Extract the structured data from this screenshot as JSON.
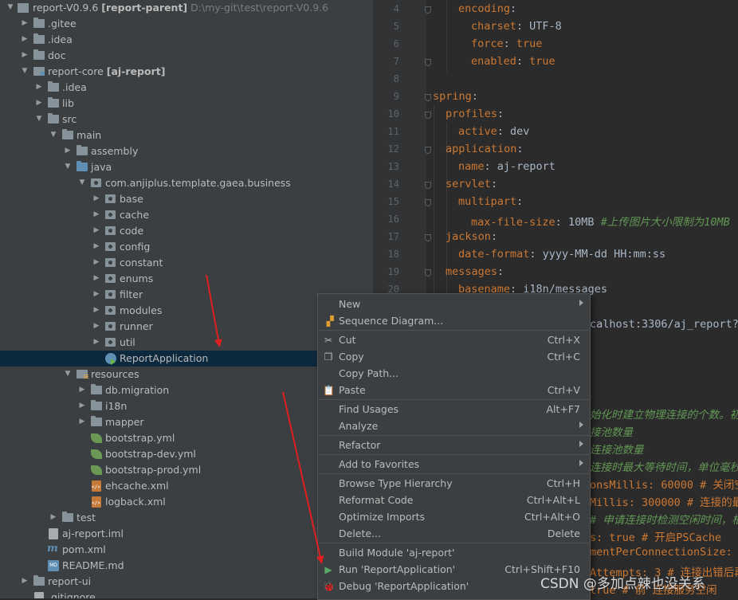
{
  "project": {
    "root_name": "report-V0.9.6",
    "root_module": "[report-parent]",
    "root_path": "D:\\my-git\\test\\report-V0.9.6",
    "items": [
      {
        "label": ".gitee"
      },
      {
        "label": ".idea"
      },
      {
        "label": "doc"
      },
      {
        "label": "report-core",
        "module": "[aj-report]"
      },
      {
        "label": ".idea"
      },
      {
        "label": "lib"
      },
      {
        "label": "src"
      },
      {
        "label": "main"
      },
      {
        "label": "assembly"
      },
      {
        "label": "java"
      },
      {
        "label": "com.anjiplus.template.gaea.business"
      },
      {
        "label": "base"
      },
      {
        "label": "cache"
      },
      {
        "label": "code"
      },
      {
        "label": "config"
      },
      {
        "label": "constant"
      },
      {
        "label": "enums"
      },
      {
        "label": "filter"
      },
      {
        "label": "modules"
      },
      {
        "label": "runner"
      },
      {
        "label": "util"
      },
      {
        "label": "ReportApplication"
      },
      {
        "label": "resources"
      },
      {
        "label": "db.migration"
      },
      {
        "label": "i18n"
      },
      {
        "label": "mapper"
      },
      {
        "label": "bootstrap.yml"
      },
      {
        "label": "bootstrap-dev.yml"
      },
      {
        "label": "bootstrap-prod.yml"
      },
      {
        "label": "ehcache.xml"
      },
      {
        "label": "logback.xml"
      },
      {
        "label": "test"
      },
      {
        "label": "aj-report.iml"
      },
      {
        "label": "pom.xml"
      },
      {
        "label": "README.md"
      },
      {
        "label": "report-ui"
      },
      {
        "label": ".gitignore"
      }
    ]
  },
  "editor": {
    "line_numbers": [
      "4",
      "5",
      "6",
      "7",
      "8",
      "9",
      "10",
      "11",
      "12",
      "13",
      "14",
      "15",
      "16",
      "17",
      "18",
      "19",
      "20"
    ],
    "lines": [
      {
        "key": "encoding",
        "sep": ":",
        "val": "",
        "comment": ""
      },
      {
        "key": "charset",
        "sep": ": ",
        "val": "UTF-8",
        "comment": ""
      },
      {
        "key": "force",
        "sep": ": ",
        "val": "true",
        "comment": ""
      },
      {
        "key": "enabled",
        "sep": ": ",
        "val": "true",
        "comment": ""
      },
      {
        "key": "",
        "sep": "",
        "val": "",
        "comment": ""
      },
      {
        "key": "spring",
        "sep": ":",
        "val": "",
        "comment": ""
      },
      {
        "key": "profiles",
        "sep": ":",
        "val": "",
        "comment": ""
      },
      {
        "key": "active",
        "sep": ": ",
        "val": "dev",
        "comment": ""
      },
      {
        "key": "application",
        "sep": ":",
        "val": "",
        "comment": ""
      },
      {
        "key": "name",
        "sep": ": ",
        "val": "aj-report",
        "comment": ""
      },
      {
        "key": "servlet",
        "sep": ":",
        "val": "",
        "comment": ""
      },
      {
        "key": "multipart",
        "sep": ":",
        "val": "",
        "comment": ""
      },
      {
        "key": "max-file-size",
        "sep": ": ",
        "val": "10MB ",
        "comment": "#上传图片大小限制为10MB"
      },
      {
        "key": "jackson",
        "sep": ":",
        "val": "",
        "comment": ""
      },
      {
        "key": "date-format",
        "sep": ": ",
        "val": "yyyy-MM-dd HH:mm:ss",
        "comment": ""
      },
      {
        "key": "messages",
        "sep": ":",
        "val": "",
        "comment": ""
      },
      {
        "key": "basename",
        "sep": ": ",
        "val": "i18n/messages",
        "comment": ""
      }
    ],
    "peek": [
      {
        "text": "calhost:3306/aj_report?c",
        "kind": "val"
      },
      {
        "text": "始化时建立物理连接的个数。初",
        "kind": "comment"
      },
      {
        "text": "接池数量",
        "kind": "comment"
      },
      {
        "text": "连接池数量",
        "kind": "comment"
      },
      {
        "text": "连接时最大等待时间，单位毫秒。",
        "kind": "comment"
      },
      {
        "text": "onsMillis: 60000 # 关闭空",
        "kind": "mixed"
      },
      {
        "text": "Millis: 300000 # 连接的最",
        "kind": "mixed"
      },
      {
        "text": "# 申请连接时检测空闲时间，根据",
        "kind": "comment"
      },
      {
        "text": "s: true # 开启PSCache",
        "kind": "mixed"
      },
      {
        "text": "mentPerConnectionSize: 2",
        "kind": "mixed"
      },
      {
        "text": "Attempts: 3 # 连接出错后再",
        "kind": "mixed"
      },
      {
        "text": "true # 前 连接服务空闲",
        "kind": "mixed"
      }
    ]
  },
  "menu": {
    "items": [
      {
        "label": "New",
        "shortcut": "",
        "submenu": true,
        "icon": ""
      },
      {
        "label": "Sequence Diagram...",
        "shortcut": "",
        "submenu": false,
        "icon": "sequence-diagram-icon"
      },
      {
        "label": "Cut",
        "shortcut": "Ctrl+X",
        "submenu": false,
        "icon": "scissors-icon"
      },
      {
        "label": "Copy",
        "shortcut": "Ctrl+C",
        "submenu": false,
        "icon": "copy-icon"
      },
      {
        "label": "Copy Path...",
        "shortcut": "",
        "submenu": false,
        "icon": ""
      },
      {
        "label": "Paste",
        "shortcut": "Ctrl+V",
        "submenu": false,
        "icon": "clipboard-icon"
      },
      {
        "label": "Find Usages",
        "shortcut": "Alt+F7",
        "submenu": false,
        "icon": ""
      },
      {
        "label": "Analyze",
        "shortcut": "",
        "submenu": true,
        "icon": ""
      },
      {
        "label": "Refactor",
        "shortcut": "",
        "submenu": true,
        "icon": ""
      },
      {
        "label": "Add to Favorites",
        "shortcut": "",
        "submenu": true,
        "icon": ""
      },
      {
        "label": "Browse Type Hierarchy",
        "shortcut": "Ctrl+H",
        "submenu": false,
        "icon": ""
      },
      {
        "label": "Reformat Code",
        "shortcut": "Ctrl+Alt+L",
        "submenu": false,
        "icon": ""
      },
      {
        "label": "Optimize Imports",
        "shortcut": "Ctrl+Alt+O",
        "submenu": false,
        "icon": ""
      },
      {
        "label": "Delete...",
        "shortcut": "Delete",
        "submenu": false,
        "icon": ""
      },
      {
        "label": "Build Module 'aj-report'",
        "shortcut": "",
        "submenu": false,
        "icon": ""
      },
      {
        "label": "Run 'ReportApplication'",
        "shortcut": "Ctrl+Shift+F10",
        "submenu": false,
        "icon": "run-icon"
      },
      {
        "label": "Debug 'ReportApplication'",
        "shortcut": "",
        "submenu": false,
        "icon": "debug-icon"
      }
    ]
  },
  "watermark": "CSDN @多加点辣也没关系"
}
